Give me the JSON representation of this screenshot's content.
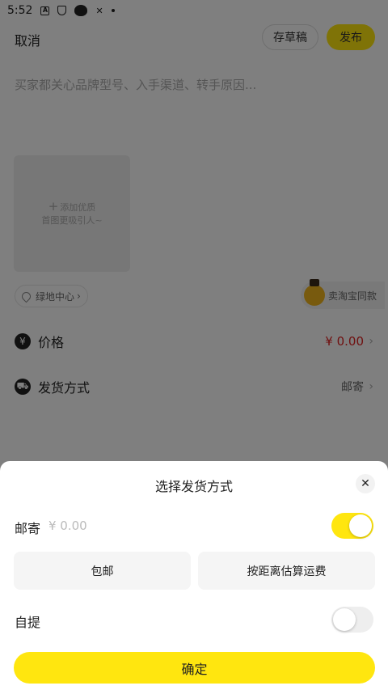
{
  "status_bar": {
    "time": "5:52",
    "icons": [
      "a-icon",
      "shield-icon",
      "cat-icon",
      "mute-icon",
      "dot-icon"
    ]
  },
  "header": {
    "cancel_label": "取消",
    "draft_label": "存草稿",
    "publish_label": "发布"
  },
  "composer": {
    "description_placeholder": "买家都关心品牌型号、入手渠道、转手原因...",
    "photo_hint_line1": "添加优质",
    "photo_hint_line2": "首图更吸引人~",
    "location_label": "绿地中心",
    "same_item_label": "卖淘宝同款"
  },
  "rows": {
    "price": {
      "label": "价格",
      "value": "¥ 0.00",
      "icon": "yen-icon"
    },
    "shipping": {
      "label": "发货方式",
      "value": "邮寄",
      "icon": "delivery-icon"
    }
  },
  "sheet": {
    "title": "选择发货方式",
    "mail": {
      "label": "邮寄",
      "price_placeholder": "¥ 0.00",
      "enabled": true
    },
    "free_shipping_label": "包邮",
    "distance_label": "按距离估算运费",
    "pickup": {
      "label": "自提",
      "enabled": false
    },
    "confirm_label": "确定"
  },
  "colors": {
    "accent": "#ffe60f",
    "price_red": "#e02020"
  }
}
